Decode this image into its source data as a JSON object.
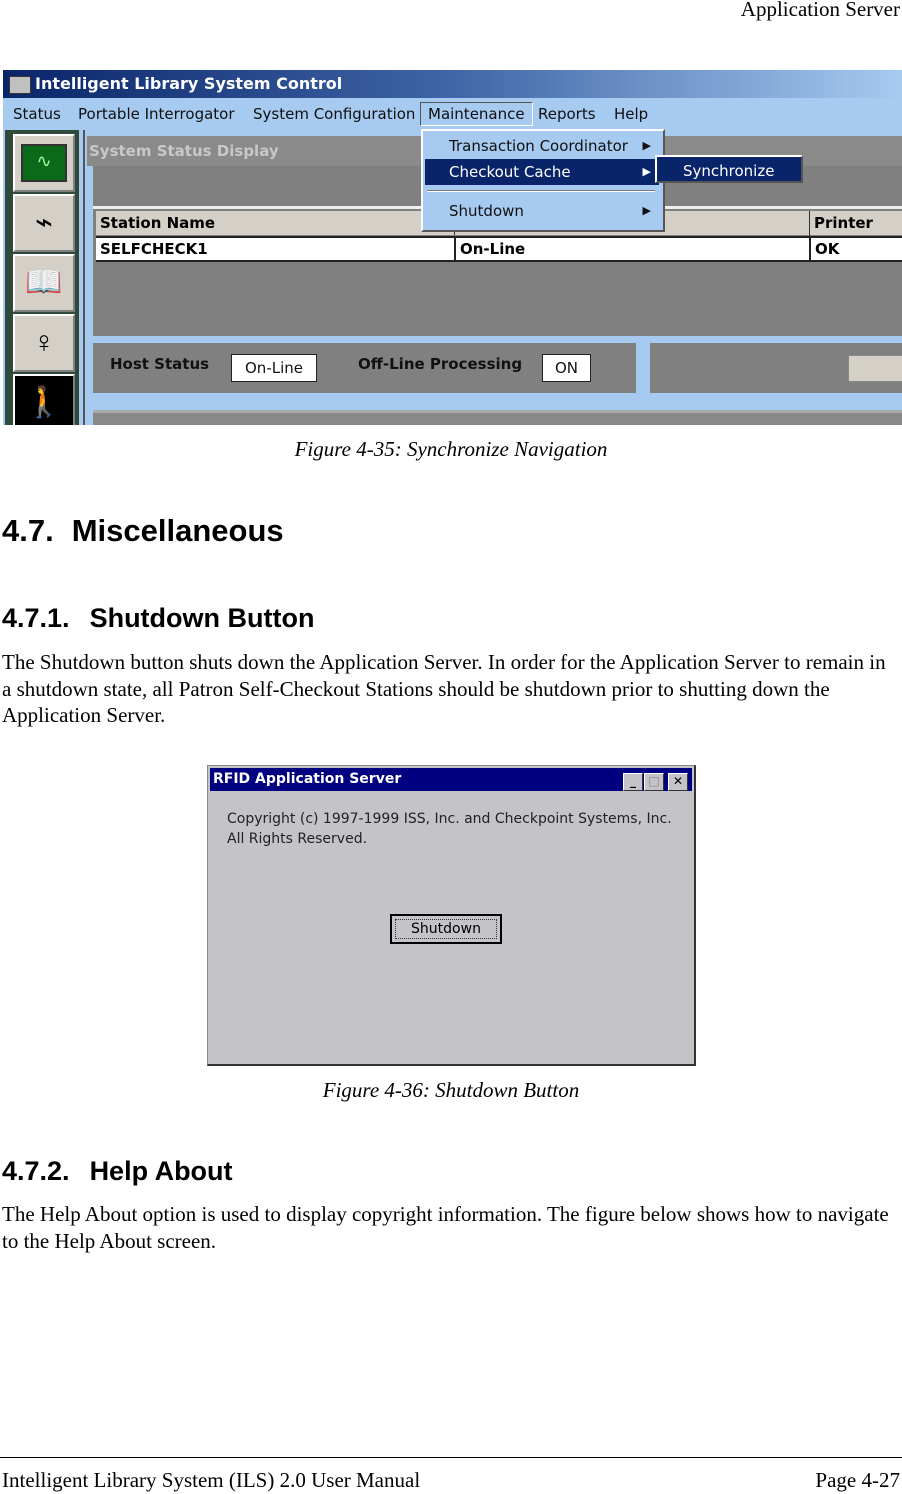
{
  "page_header": "Application Server",
  "figure1": {
    "caption": "Figure 4-35: Synchronize Navigation",
    "window_title": "Intelligent Library System Control",
    "menubar": [
      "Status",
      "Portable Interrogator",
      "System Configuration",
      "Maintenance",
      "Reports",
      "Help"
    ],
    "panel_title": "System Status Display",
    "table": {
      "headers": [
        "Station Name",
        "",
        "Printer Sta"
      ],
      "rows": [
        [
          "SELFCHECK1",
          "On-Line",
          "OK"
        ]
      ]
    },
    "host_status_label": "Host Status",
    "host_status_value": "On-Line",
    "offline_label": "Off-Line Processing",
    "offline_value": "ON",
    "maintenance_menu": [
      "Transaction Coordinator",
      "Checkout Cache",
      "Shutdown"
    ],
    "submenu": [
      "Synchronize"
    ],
    "colors": {
      "menu_bg": "#a6caf0",
      "highlight": "#0a246a"
    }
  },
  "section_47": {
    "number": "4.7.",
    "title": "Miscellaneous"
  },
  "section_471": {
    "number": "4.7.1.",
    "title": "Shutdown Button",
    "body": "The Shutdown button shuts down the Application Server. In order for the Application Server to remain in a shutdown state, all Patron Self-Checkout Stations should be shutdown prior to shutting down the Application Server."
  },
  "figure2": {
    "caption": "Figure 4-36: Shutdown Button",
    "window_title": "RFID Application Server",
    "copyright_line1": "Copyright (c) 1997-1999 ISS, Inc. and Checkpoint Systems, Inc.",
    "copyright_line2": "All Rights Reserved.",
    "shutdown_button": "Shutdown"
  },
  "section_472": {
    "number": "4.7.2.",
    "title": "Help About",
    "body": "The Help About option is used to display copyright information. The figure below shows how to navigate to the Help About screen."
  },
  "footer": {
    "left": "Intelligent Library System (ILS) 2.0 User Manual",
    "right": "Page 4-27"
  }
}
